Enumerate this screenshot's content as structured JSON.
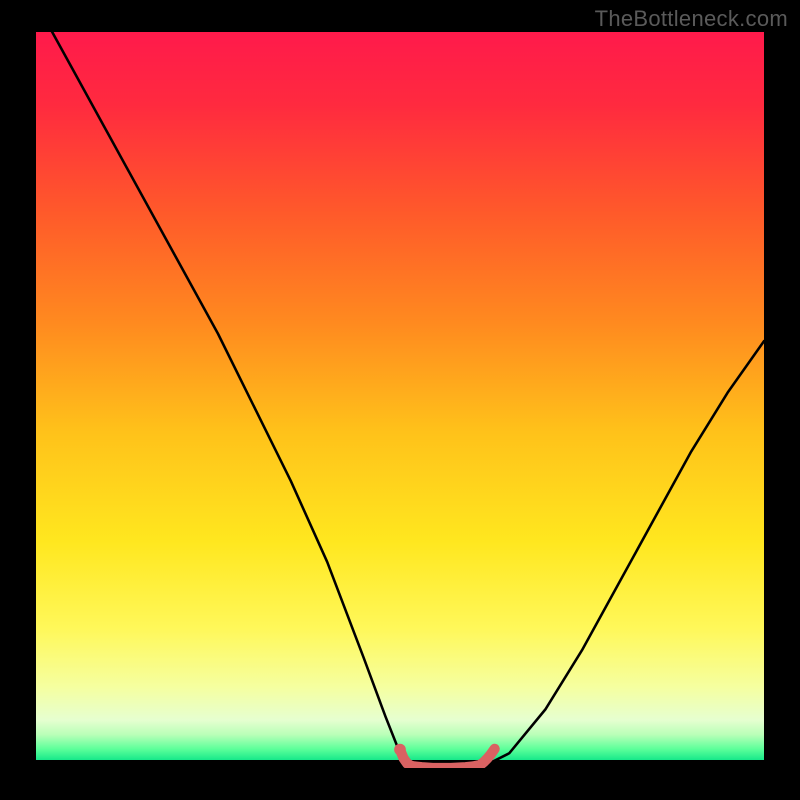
{
  "watermark": "TheBottleneck.com",
  "chart_data": {
    "type": "line",
    "title": "",
    "xlabel": "",
    "ylabel": "",
    "xlim": [
      0,
      100
    ],
    "ylim": [
      0,
      100
    ],
    "series": [
      {
        "name": "bottleneck-curve",
        "x": [
          0,
          5,
          10,
          15,
          20,
          25,
          30,
          35,
          40,
          45,
          48,
          50,
          52,
          55,
          58,
          60,
          62,
          65,
          70,
          75,
          80,
          85,
          90,
          95,
          100
        ],
        "values": [
          104,
          95,
          86,
          77,
          68,
          59,
          49,
          39,
          28,
          15,
          7,
          2,
          0.5,
          0,
          0,
          0,
          0.5,
          2,
          8,
          16,
          25,
          34,
          43,
          51,
          58
        ]
      },
      {
        "name": "optimal-zone-marker",
        "x": [
          50,
          50.5,
          51,
          51.5,
          52,
          53,
          54.5,
          57,
          59,
          60,
          61,
          61.5,
          62,
          62.5,
          63
        ],
        "values": [
          2.5,
          1.3,
          0.6,
          0.3,
          0.2,
          0.1,
          0.0,
          0.0,
          0.1,
          0.2,
          0.4,
          0.8,
          1.3,
          1.9,
          2.6
        ]
      }
    ],
    "gradient_stops": [
      {
        "offset": 0.0,
        "color": "#ff1a4b"
      },
      {
        "offset": 0.1,
        "color": "#ff2a3f"
      },
      {
        "offset": 0.25,
        "color": "#ff5a2a"
      },
      {
        "offset": 0.4,
        "color": "#ff8a1f"
      },
      {
        "offset": 0.55,
        "color": "#ffc21a"
      },
      {
        "offset": 0.7,
        "color": "#ffe71f"
      },
      {
        "offset": 0.82,
        "color": "#fff85a"
      },
      {
        "offset": 0.9,
        "color": "#f5ffa0"
      },
      {
        "offset": 0.945,
        "color": "#e6ffd0"
      },
      {
        "offset": 0.965,
        "color": "#baffb8"
      },
      {
        "offset": 0.985,
        "color": "#5cff9a"
      },
      {
        "offset": 1.0,
        "color": "#17e88a"
      }
    ],
    "marker_color": "#d96262",
    "curve_color": "#000000"
  }
}
